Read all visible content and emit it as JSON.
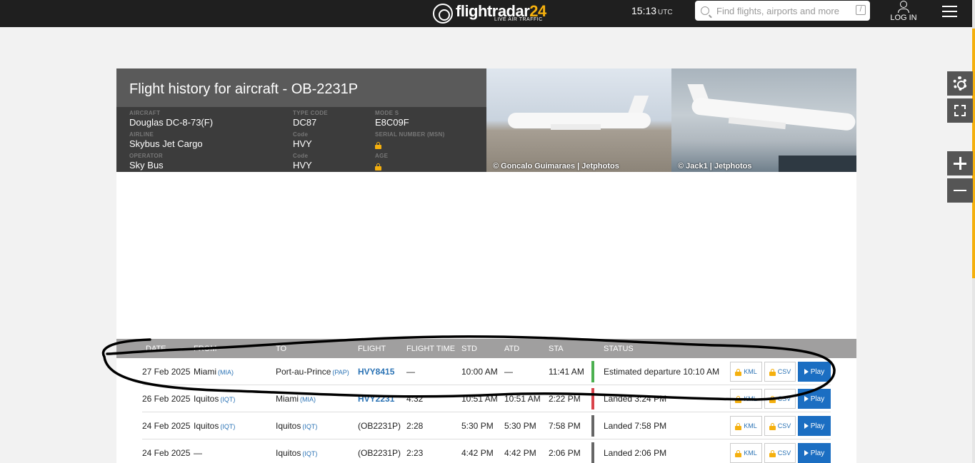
{
  "topbar": {
    "logo_text": "flightradar",
    "logo_num": "24",
    "logo_sub": "LIVE AIR TRAFFIC",
    "time": "15:13",
    "time_zone": "UTC",
    "search_placeholder": "Find flights, airports and more",
    "search_shortcut": "/",
    "login_label": "LOG IN"
  },
  "header": {
    "title": "Flight history for aircraft - OB-2231P",
    "aircraft_label": "AIRCRAFT",
    "aircraft": "Douglas DC-8-73(F)",
    "type_code_label": "TYPE CODE",
    "type_code": "DC87",
    "mode_s_label": "MODE S",
    "mode_s": "E8C09F",
    "airline_label": "AIRLINE",
    "airline": "Skybus Jet Cargo",
    "airline_code_label": "Code",
    "airline_code": "HVY",
    "serial_label": "SERIAL NUMBER (MSN)",
    "operator_label": "OPERATOR",
    "operator": "Sky Bus",
    "operator_code_label": "Code",
    "operator_code": "HVY",
    "age_label": "AGE"
  },
  "photos": [
    {
      "credit": "© Goncalo Guimaraes | Jetphotos"
    },
    {
      "credit": "© Jack1 | Jetphotos"
    }
  ],
  "table": {
    "headers": [
      "DATE",
      "FROM",
      "TO",
      "FLIGHT",
      "FLIGHT TIME",
      "STD",
      "ATD",
      "STA",
      "",
      "STATUS"
    ],
    "button_kml": "KML",
    "button_csv": "CSV",
    "button_play": "Play",
    "rows": [
      {
        "date": "27 Feb 2025",
        "from": "Miami",
        "from_code": "(MIA)",
        "to": "Port-au-Prince",
        "to_code": "(PAP)",
        "flight": "HVY8415",
        "flight_time": "—",
        "std": "10:00 AM",
        "atd": "—",
        "sta": "11:41 AM",
        "status": "Estimated departure 10:10 AM",
        "status_color": "#4cb050"
      },
      {
        "date": "26 Feb 2025",
        "from": "Iquitos",
        "from_code": "(IQT)",
        "to": "Miami",
        "to_code": "(MIA)",
        "flight": "HVY2231",
        "flight_time": "4:32",
        "std": "10:51 AM",
        "atd": "10:51 AM",
        "sta": "2:22 PM",
        "status": "Landed 3:24 PM",
        "status_color": "#d9434b"
      },
      {
        "date": "24 Feb 2025",
        "from": "Iquitos",
        "from_code": "(IQT)",
        "to": "Iquitos",
        "to_code": "(IQT)",
        "flight": "(OB2231P)",
        "flight_time": "2:28",
        "std": "5:30 PM",
        "atd": "5:30 PM",
        "sta": "7:58 PM",
        "status": "Landed 7:58 PM",
        "status_color": "#666666"
      },
      {
        "date": "24 Feb 2025",
        "from": "—",
        "from_code": "",
        "to": "Iquitos",
        "to_code": "(IQT)",
        "flight": "(OB2231P)",
        "flight_time": "2:23",
        "std": "4:42 PM",
        "atd": "4:42 PM",
        "sta": "2:06 PM",
        "status": "Landed 2:06 PM",
        "status_color": "#666666"
      }
    ]
  }
}
